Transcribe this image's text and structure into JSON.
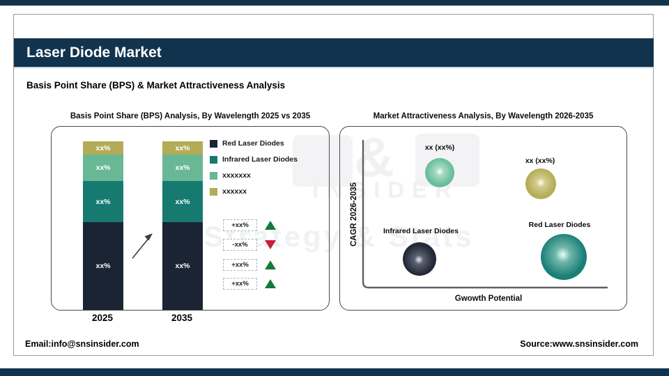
{
  "header": {
    "title": "Laser Diode Market",
    "subtitle": "Basis Point Share (BPS) & Market Attractiveness Analysis"
  },
  "footer": {
    "email": "Email:info@snsinsider.com",
    "source": "Source:www.snsinsider.com"
  },
  "watermark": {
    "ampersand": "&",
    "line1": "INSIDER",
    "line2": "Strategy & Stats"
  },
  "colors": {
    "banner_navy": "#12334d",
    "bar_navy": "#1b2433",
    "bar_teal": "#177a70",
    "bar_green": "#68b795",
    "bar_olive": "#b4ab57",
    "triangle_green": "#137a38",
    "triangle_red": "#c51f3a",
    "bubble_mint": "#68bd9b",
    "bubble_olive": "#b5ac58",
    "bubble_navy": "#232938",
    "bubble_teal": "#1a8077"
  },
  "chart_data": [
    {
      "type": "bar",
      "stacked": true,
      "title": "Basis Point Share (BPS) Analysis, By Wavelength 2025 vs 2035",
      "categories": [
        "2025",
        "2035"
      ],
      "series": [
        {
          "name": "Red Laser Diodes",
          "color": "#1b2433",
          "values": [
            "xx%",
            "xx%"
          ]
        },
        {
          "name": "Infrared Laser Diodes",
          "color": "#177a70",
          "values": [
            "xx%",
            "xx%"
          ]
        },
        {
          "name": "xxxxxxx",
          "color": "#68b795",
          "values": [
            "xx%",
            "xx%"
          ]
        },
        {
          "name": "xxxxxx",
          "color": "#b4ab57",
          "values": [
            "xx%",
            "xx%"
          ]
        }
      ],
      "change_indicators": [
        {
          "label": "+xx%",
          "direction": "up"
        },
        {
          "label": "-xx%",
          "direction": "down"
        },
        {
          "label": "+xx%",
          "direction": "up"
        },
        {
          "label": "+xx%",
          "direction": "up"
        }
      ],
      "legend_position": "right",
      "grid": false
    },
    {
      "type": "bubble",
      "title": "Market Attractiveness Analysis, By Wavelength 2026-2035",
      "xlabel": "Gwowth Potential",
      "ylabel": "CAGR 2026-2035",
      "grid": false,
      "bubbles": [
        {
          "label": "xx (xx%)",
          "color": "#68bd9b",
          "x": "low",
          "y": "high",
          "radius": 21
        },
        {
          "label": "xx (xx%)",
          "color": "#b5ac58",
          "x": "high",
          "y": "high",
          "radius": 22
        },
        {
          "label": "Infrared Laser Diodes",
          "color": "#232938",
          "x": "low",
          "y": "low",
          "radius": 24
        },
        {
          "label": "Red Laser Diodes",
          "color": "#1a8077",
          "x": "high",
          "y": "low",
          "radius": 33
        }
      ]
    }
  ]
}
